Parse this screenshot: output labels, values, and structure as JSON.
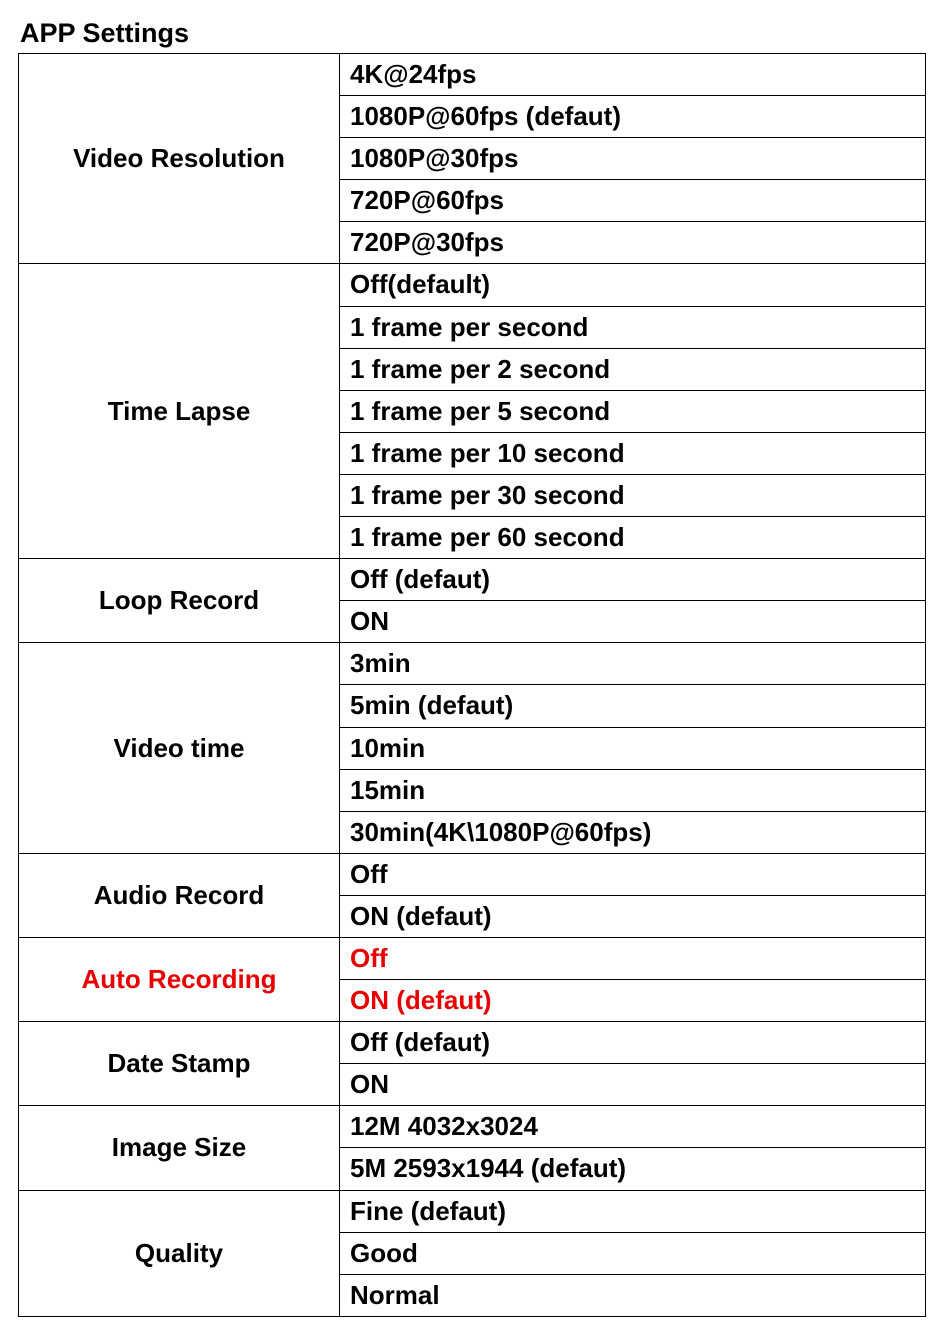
{
  "title": "APP Settings",
  "settings": [
    {
      "label": "Video Resolution",
      "highlight": false,
      "options": [
        "4K@24fps",
        "1080P@60fps (defaut)",
        "1080P@30fps",
        "720P@60fps",
        "720P@30fps"
      ]
    },
    {
      "label": "Time Lapse",
      "highlight": false,
      "options": [
        "Off(default)",
        "1 frame per second",
        "1 frame per 2 second",
        "1 frame per 5 second",
        "1 frame per 10 second",
        "1 frame per 30 second",
        "1 frame per 60 second"
      ]
    },
    {
      "label": "Loop Record",
      "highlight": false,
      "options": [
        "Off (defaut)",
        "ON"
      ]
    },
    {
      "label": "Video time",
      "highlight": false,
      "options": [
        "3min",
        "5min (defaut)",
        "10min",
        "15min",
        "30min(4K\\1080P@60fps)"
      ]
    },
    {
      "label": "Audio Record",
      "highlight": false,
      "options": [
        "Off",
        "ON (defaut)"
      ]
    },
    {
      "label": "Auto Recording",
      "highlight": true,
      "options": [
        "Off",
        "ON (defaut)"
      ]
    },
    {
      "label": "Date Stamp",
      "highlight": false,
      "options": [
        "Off (defaut)",
        "ON"
      ]
    },
    {
      "label": "Image Size",
      "highlight": false,
      "options": [
        "12M 4032x3024",
        "5M 2593x1944 (defaut)"
      ]
    },
    {
      "label": "Quality",
      "highlight": false,
      "options": [
        "Fine (defaut)",
        "Good",
        "Normal"
      ]
    }
  ]
}
